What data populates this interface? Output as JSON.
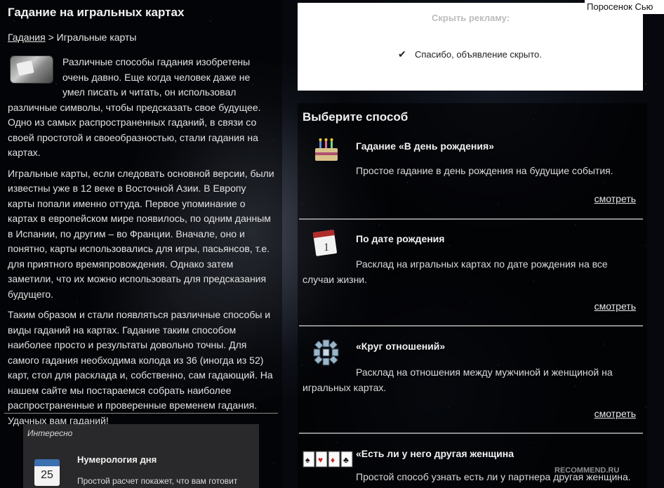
{
  "page": {
    "title": "Гадание на игральных картах",
    "breadcrumb": {
      "parent": "Гадания",
      "separator": ">",
      "current": "Игральные карты"
    }
  },
  "article": {
    "paragraphs": [
      "Различные способы гадания изобретены очень давно. Еще когда человек даже не умел писать и читать, он использовал различные символы, чтобы предсказать свое будущее. Одно из самых распространенных гаданий, в связи со своей простотой и своеобразностью, стали гадания на картах.",
      "Игральные карты, если следовать основной версии, были известны уже в 12 веке в Восточной Азии. В Европу карты попали именно оттуда. Первое упоминание о картах в европейском мире появилось, по одним данным в Испании, по другим – во Франции. Вначале, оно и понятно, карты использовались для игры, пасьянсов, т.е. для приятного времяпровождения. Однако затем заметили, что их можно использовать для предсказания будущего.",
      "Таким образом и стали появляться различные способы и виды гаданий на картах. Гадание таким способом наиболее просто и результаты довольно точны. Для самого гадания необходима колода из 36 (иногда из 52) карт, стол для расклада и, собственно, сам гадающий. На нашем сайте мы постараемся собрать наиболее распространенные и проверенные временем гадания. Удачных вам гаданий!"
    ]
  },
  "interesting": {
    "label": "Интересно",
    "title": "Нумерология дня",
    "calendar_day": "25",
    "description": "Простой расчет покажет, что вам готовит"
  },
  "ad": {
    "hide_label": "Скрыть рекламу:",
    "thanks": "Спасибо, объявление скрыто.",
    "top_text": "Поросенок Сью"
  },
  "choose": {
    "heading": "Выберите способ",
    "methods": [
      {
        "title": "Гадание «В день рождения»",
        "description": "Простое гадание в день рождения на будущие события.",
        "more": "смотреть",
        "icon": "birthday-cake-icon"
      },
      {
        "title": "По дате рождения",
        "description": "Расклад на игральных картах по дате рождения на все случаи жизни.",
        "more": "смотреть",
        "icon": "calendar-icon",
        "calendar_day": "1"
      },
      {
        "title": "«Круг отношений»",
        "description": "Расклад на отношения между мужчиной и женщиной на игральных картах.",
        "more": "смотреть",
        "icon": "card-circle-icon"
      },
      {
        "title": "«Есть ли у него другая женщина",
        "description": "Простой способ узнать есть ли у партнера другая женщина.",
        "icon": "playing-cards-icon"
      }
    ]
  },
  "watermark": "RECOMMEND.RU"
}
